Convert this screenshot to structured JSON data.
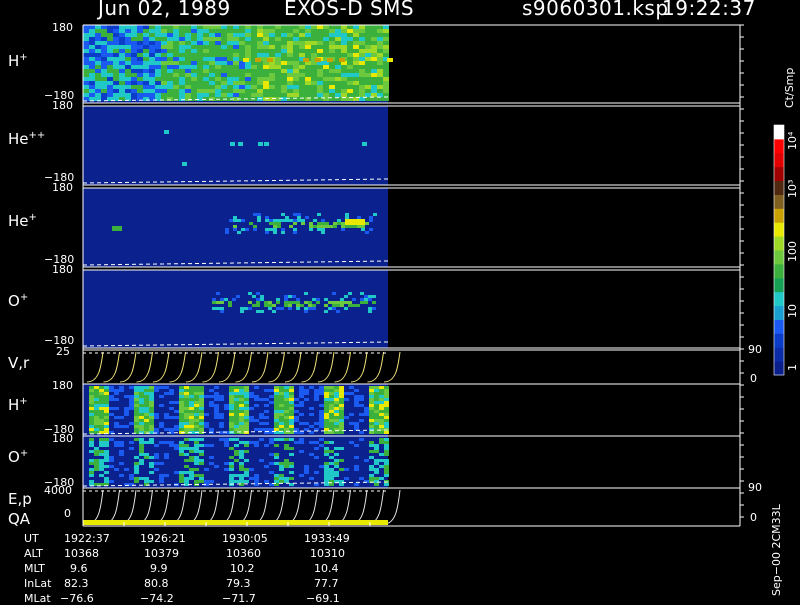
{
  "header": {
    "date": "Jun 02, 1989",
    "mission": "EXOS-D SMS",
    "file": "s9060301.ksp",
    "time": "19:22:37"
  },
  "colorbar": {
    "unit": "Ct/Smp",
    "ticks": [
      {
        "label": "1",
        "value": 1
      },
      {
        "label": "10",
        "value": 10
      },
      {
        "label": "100",
        "value": 100
      },
      {
        "label": "10³",
        "value": 1000
      },
      {
        "label": "10⁴",
        "value": 10000
      }
    ],
    "colors": [
      "#0a1e8c",
      "#0a2ca8",
      "#0b3cc8",
      "#1a5af0",
      "#1aa0d0",
      "#20c8c8",
      "#15a055",
      "#3cb03c",
      "#6cc83c",
      "#a0d828",
      "#e8e800",
      "#c8a000",
      "#806020",
      "#502810",
      "#a00000",
      "#e00000",
      "#ff0000",
      "#ffffff"
    ]
  },
  "panels": [
    {
      "name": "H",
      "sup": "+",
      "ytop": "180",
      "ybot": "−180"
    },
    {
      "name": "He",
      "sup": "++",
      "ytop": "180",
      "ybot": "−180"
    },
    {
      "name": "He",
      "sup": "+",
      "ytop": "180",
      "ybot": "−180"
    },
    {
      "name": "O",
      "sup": "+",
      "ytop": "180",
      "ybot": "−180"
    },
    {
      "name": "V,r",
      "sup": "",
      "ytop": "25",
      "ybot": "",
      "right": [
        "90",
        "0"
      ]
    },
    {
      "name": "H",
      "sup": "+",
      "ytop": "180",
      "ybot": "−180"
    },
    {
      "name": "O",
      "sup": "+",
      "ytop": "180",
      "ybot": "−180"
    },
    {
      "name": "E,p",
      "sup": "",
      "ytop": "4000",
      "ybot": "0",
      "right": [
        "90",
        "0"
      ],
      "sublabel": "QA"
    }
  ],
  "footer": {
    "labels": [
      "UT",
      "ALT",
      "MLT",
      "InLat",
      "MLat"
    ],
    "columns": [
      [
        "1922:37",
        "10368",
        "9.6",
        "82.3",
        "−76.6"
      ],
      [
        "1926:21",
        "10379",
        "9.9",
        "80.8",
        "−74.2"
      ],
      [
        "1930:05",
        "10360",
        "10.2",
        "79.3",
        "−71.7"
      ],
      [
        "1933:49",
        "10310",
        "10.4",
        "77.7",
        "−69.1"
      ]
    ],
    "side_note": "Sep−00 2CM33L"
  },
  "chart_data": {
    "type": "heatmap",
    "title": "Jun 02, 1989   EXOS-D SMS",
    "x": [
      "1922:37",
      "1926:21",
      "1930:05",
      "1933:49"
    ],
    "panels": [
      {
        "name": "H+",
        "ylim": [
          -180,
          180
        ]
      },
      {
        "name": "He++",
        "ylim": [
          -180,
          180
        ]
      },
      {
        "name": "He+",
        "ylim": [
          -180,
          180
        ]
      },
      {
        "name": "O+",
        "ylim": [
          -180,
          180
        ]
      },
      {
        "name": "V,r",
        "ylim": [
          0,
          25
        ],
        "right_ylim": [
          0,
          90
        ]
      },
      {
        "name": "H+",
        "ylim": [
          -180,
          180
        ]
      },
      {
        "name": "O+",
        "ylim": [
          -180,
          180
        ]
      },
      {
        "name": "E,p",
        "ylim": [
          0,
          4000
        ],
        "right_ylim": [
          0,
          90
        ]
      }
    ],
    "colorscale": {
      "type": "log",
      "range": [
        1,
        10000
      ],
      "unit": "Ct/Smp"
    }
  }
}
